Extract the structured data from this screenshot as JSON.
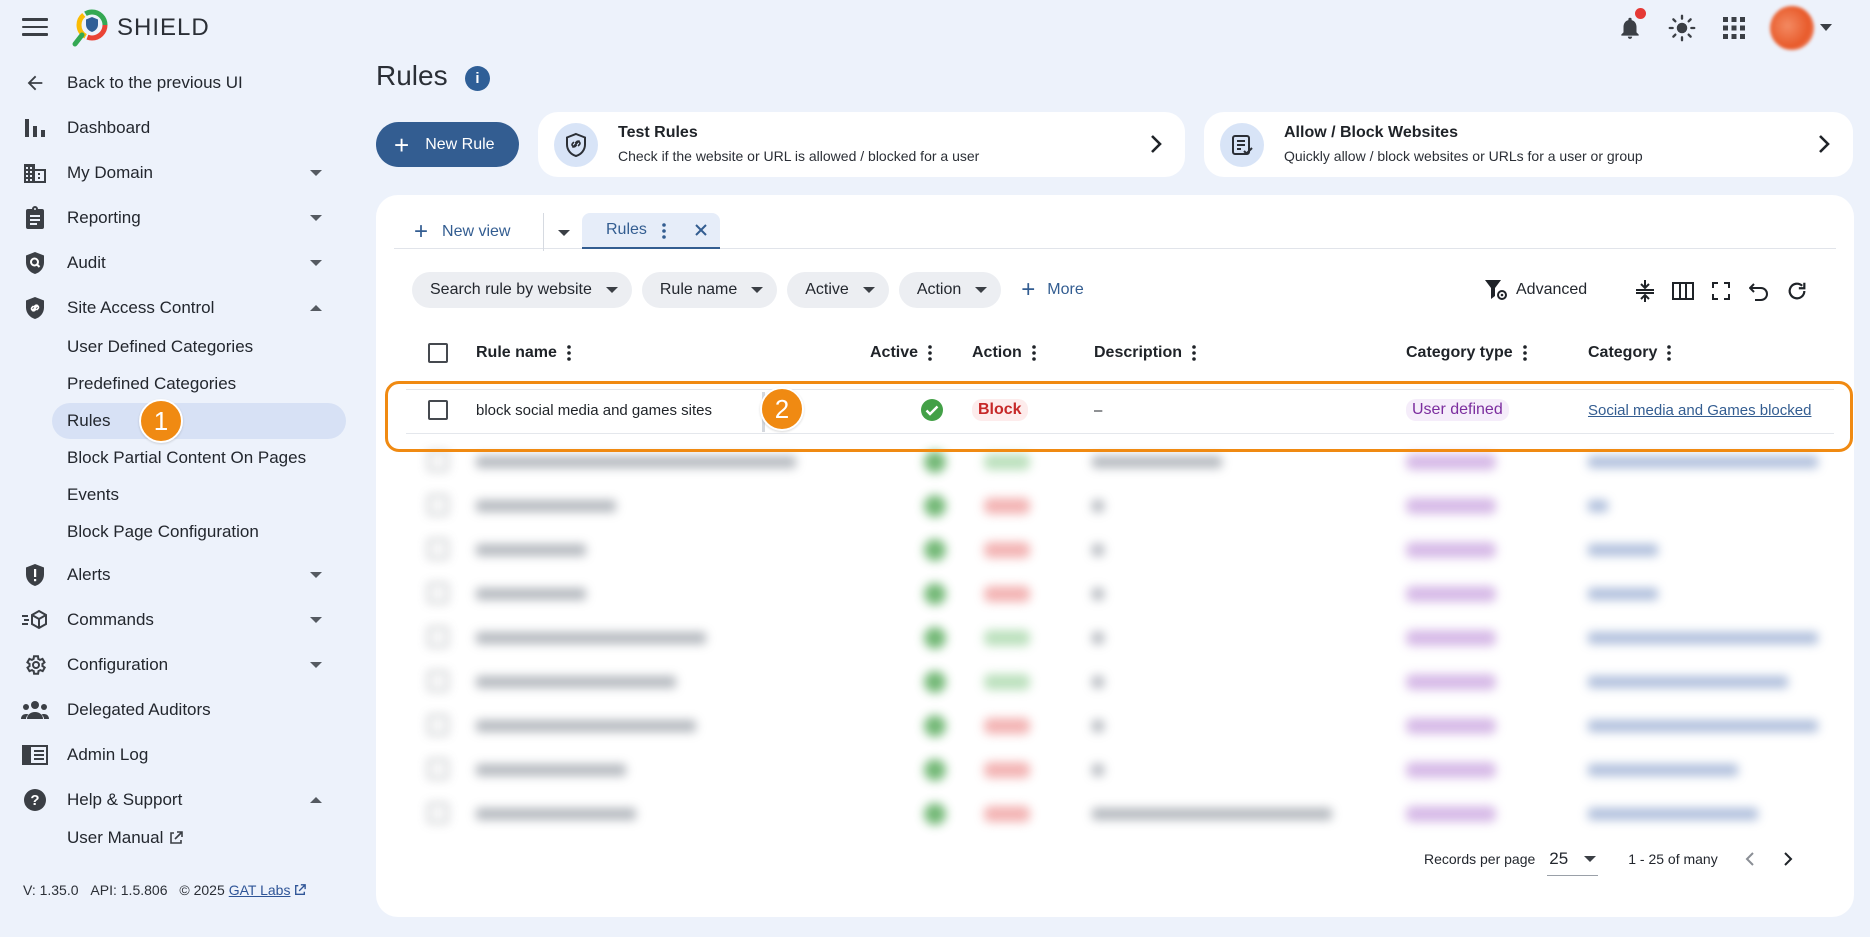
{
  "app": {
    "brand": "SHIELD"
  },
  "sidebar": {
    "back": "Back to the previous UI",
    "items": [
      {
        "label": "Dashboard"
      },
      {
        "label": "My Domain"
      },
      {
        "label": "Reporting"
      },
      {
        "label": "Audit"
      },
      {
        "label": "Site Access Control"
      },
      {
        "label": "Alerts"
      },
      {
        "label": "Commands"
      },
      {
        "label": "Configuration"
      },
      {
        "label": "Delegated Auditors"
      },
      {
        "label": "Admin Log"
      },
      {
        "label": "Help & Support"
      }
    ],
    "site_access_sub": [
      "User Defined Categories",
      "Predefined Categories",
      "Rules",
      "Block Partial Content On Pages",
      "Events",
      "Block Page Configuration"
    ],
    "help_sub": [
      "User Manual"
    ],
    "step_badge": "1",
    "version": "V: 1.35.0",
    "api": "API: 1.5.806",
    "copyright": "© 2025",
    "company": "GAT Labs"
  },
  "page": {
    "title": "Rules"
  },
  "actions": {
    "new_rule": "New Rule",
    "test_rules": {
      "title": "Test Rules",
      "subtitle": "Check if the website or URL is allowed / blocked for a user"
    },
    "allow_block": {
      "title": "Allow / Block Websites",
      "subtitle": "Quickly allow / block websites or URLs for a user or group"
    }
  },
  "tabs": {
    "new_view": "New view",
    "active_tab": "Rules"
  },
  "filters": {
    "chips": [
      "Search rule by website",
      "Rule name",
      "Active",
      "Action"
    ],
    "more": "More",
    "advanced": "Advanced"
  },
  "table": {
    "columns": [
      "Rule name",
      "Active",
      "Action",
      "Description",
      "Category type",
      "Category"
    ],
    "highlighted_row": {
      "rule_name": "block social media and games sites",
      "action": "Block",
      "description": "–",
      "category_type": "User defined",
      "category": "Social media and Games blocked"
    },
    "step_badge": "2"
  },
  "pagination": {
    "records_label": "Records per page",
    "per_page": "25",
    "range": "1 - 25 of many"
  },
  "colors": {
    "primary": "#335d91",
    "highlight": "#f08a12",
    "block": "#c62828",
    "user_defined": "#7b2d9e",
    "active": "#43a047"
  }
}
